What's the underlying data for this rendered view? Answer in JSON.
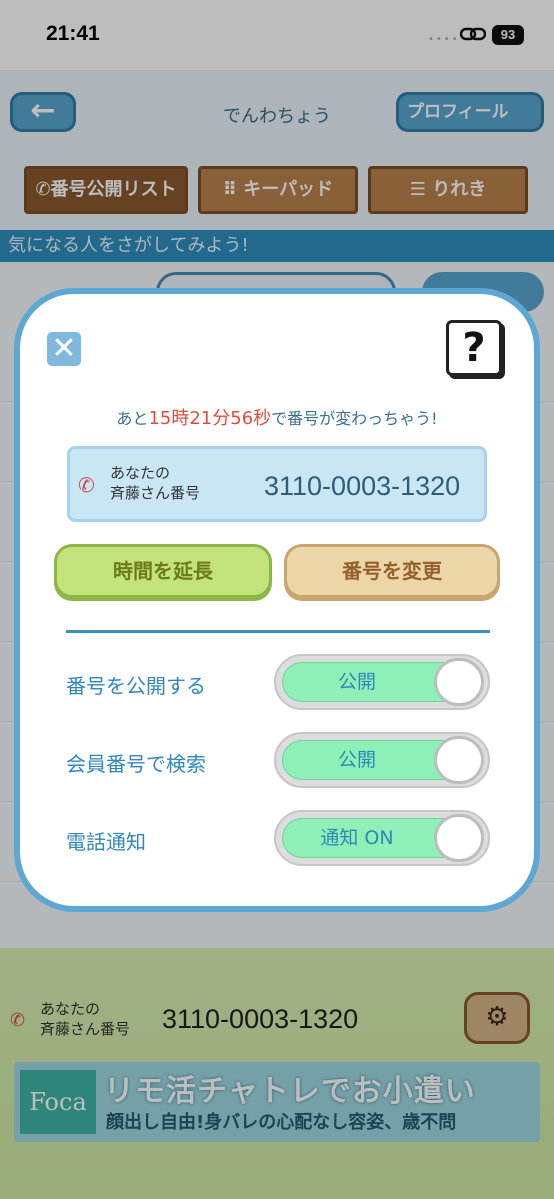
{
  "status_bar": {
    "time": "21:41",
    "battery": "93"
  },
  "header": {
    "back_icon": "arrow-left-icon",
    "title": "でんわちょう",
    "profile_label": "プロフィール"
  },
  "tabs": [
    {
      "label": "番号公開リスト",
      "icon": "phone-icon"
    },
    {
      "label": "キーパッド",
      "icon": "keypad-icon"
    },
    {
      "label": "りれき",
      "icon": "list-icon"
    }
  ],
  "subheader": "気になる人をさがしてみよう!",
  "bottom": {
    "label_line1": "あなたの",
    "label_line2": "斉藤さん番号",
    "number": "3110-0003-1320",
    "settings_icon": "gear-icon"
  },
  "ad": {
    "logo": "Foca",
    "title": "リモ活チャトレでお小遣い",
    "subtitle": "顔出し自由!身バレの心配なし容姿、歳不問"
  },
  "modal": {
    "close_icon": "close-icon",
    "help_label": "?",
    "countdown_prefix": "あと",
    "countdown_time": "15時21分56秒",
    "countdown_suffix": "で番号が変わっちゃう!",
    "number_label_line1": "あなたの",
    "number_label_line2": "斉藤さん番号",
    "number": "3110-0003-1320",
    "extend_label": "時間を延長",
    "change_label": "番号を変更",
    "settings": [
      {
        "label": "番号を公開する",
        "toggle_text": "公開",
        "on": true
      },
      {
        "label": "会員番号で検索",
        "toggle_text": "公開",
        "on": true
      },
      {
        "label": "電話通知",
        "toggle_text": "通知 ON",
        "on": true
      }
    ]
  },
  "colors": {
    "accent": "#2f87ba",
    "countdown_red": "#e24b3b",
    "toggle_on": "#8ef0b6"
  }
}
